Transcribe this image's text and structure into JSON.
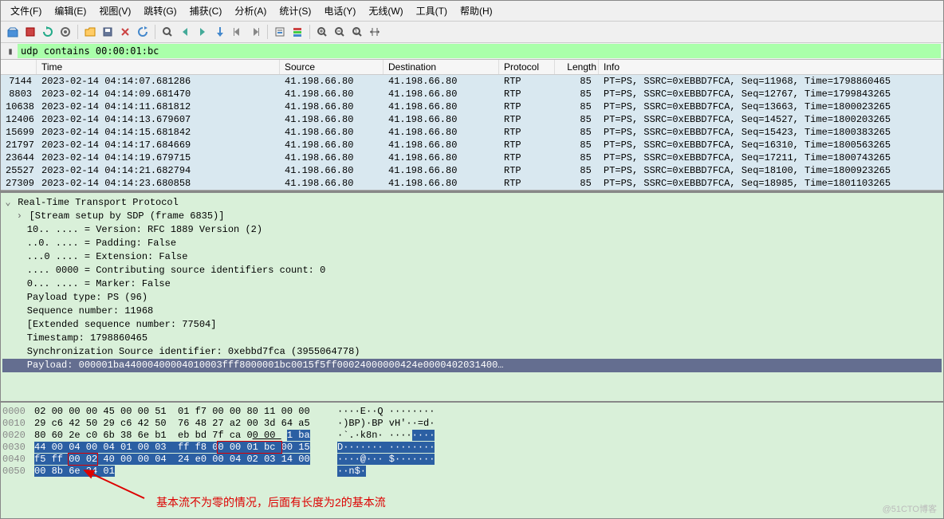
{
  "menu": [
    "文件(F)",
    "编辑(E)",
    "视图(V)",
    "跳转(G)",
    "捕获(C)",
    "分析(A)",
    "统计(S)",
    "电话(Y)",
    "无线(W)",
    "工具(T)",
    "帮助(H)"
  ],
  "filter": {
    "value": "udp contains 00:00:01:bc"
  },
  "columns": {
    "no": "",
    "time": "Time",
    "source": "Source",
    "destination": "Destination",
    "protocol": "Protocol",
    "length": "Length",
    "info": "Info"
  },
  "packets": [
    {
      "no": "7144",
      "time": "2023-02-14 04:14:07.681286",
      "src": "41.198.66.80",
      "dst": "41.198.66.80",
      "proto": "RTP",
      "len": "85",
      "info": "PT=PS, SSRC=0xEBBD7FCA, Seq=11968, Time=1798860465"
    },
    {
      "no": "8803",
      "time": "2023-02-14 04:14:09.681470",
      "src": "41.198.66.80",
      "dst": "41.198.66.80",
      "proto": "RTP",
      "len": "85",
      "info": "PT=PS, SSRC=0xEBBD7FCA, Seq=12767, Time=1799843265"
    },
    {
      "no": "10638",
      "time": "2023-02-14 04:14:11.681812",
      "src": "41.198.66.80",
      "dst": "41.198.66.80",
      "proto": "RTP",
      "len": "85",
      "info": "PT=PS, SSRC=0xEBBD7FCA, Seq=13663, Time=1800023265"
    },
    {
      "no": "12406",
      "time": "2023-02-14 04:14:13.679607",
      "src": "41.198.66.80",
      "dst": "41.198.66.80",
      "proto": "RTP",
      "len": "85",
      "info": "PT=PS, SSRC=0xEBBD7FCA, Seq=14527, Time=1800203265"
    },
    {
      "no": "15699",
      "time": "2023-02-14 04:14:15.681842",
      "src": "41.198.66.80",
      "dst": "41.198.66.80",
      "proto": "RTP",
      "len": "85",
      "info": "PT=PS, SSRC=0xEBBD7FCA, Seq=15423, Time=1800383265"
    },
    {
      "no": "21797",
      "time": "2023-02-14 04:14:17.684669",
      "src": "41.198.66.80",
      "dst": "41.198.66.80",
      "proto": "RTP",
      "len": "85",
      "info": "PT=PS, SSRC=0xEBBD7FCA, Seq=16310, Time=1800563265"
    },
    {
      "no": "23644",
      "time": "2023-02-14 04:14:19.679715",
      "src": "41.198.66.80",
      "dst": "41.198.66.80",
      "proto": "RTP",
      "len": "85",
      "info": "PT=PS, SSRC=0xEBBD7FCA, Seq=17211, Time=1800743265"
    },
    {
      "no": "25527",
      "time": "2023-02-14 04:14:21.682794",
      "src": "41.198.66.80",
      "dst": "41.198.66.80",
      "proto": "RTP",
      "len": "85",
      "info": "PT=PS, SSRC=0xEBBD7FCA, Seq=18100, Time=1800923265"
    },
    {
      "no": "27309",
      "time": "2023-02-14 04:14:23.680858",
      "src": "41.198.66.80",
      "dst": "41.198.66.80",
      "proto": "RTP",
      "len": "85",
      "info": "PT=PS, SSRC=0xEBBD7FCA, Seq=18985, Time=1801103265"
    }
  ],
  "details": {
    "header": "Real-Time Transport Protocol",
    "stream": "[Stream setup by SDP (frame 6835)]",
    "lines": [
      "10.. .... = Version: RFC 1889 Version (2)",
      "..0. .... = Padding: False",
      "...0 .... = Extension: False",
      ".... 0000 = Contributing source identifiers count: 0",
      "0... .... = Marker: False",
      "Payload type: PS (96)",
      "Sequence number: 11968",
      "[Extended sequence number: 77504]",
      "Timestamp: 1798860465",
      "Synchronization Source identifier: 0xebbd7fca (3955064778)"
    ],
    "payload": "Payload: 000001ba44000400004010003fff8000001bc0015f5ff00024000000424e0000402031400…"
  },
  "hex": {
    "offsets": [
      "0000",
      "0010",
      "0020",
      "0030",
      "0040",
      "0050"
    ],
    "bytes1": [
      "02 00 00 00 45 00 00 51",
      "29 c6 42 50 29 c6 42 50",
      "80 60 2e c0 6b 38 6e b1",
      "44 00 04 00 04 01 00 03",
      "f5 ff 00 02 40 00 00 04",
      "00 8b 6e 24 01"
    ],
    "bytes2": [
      "  01 f7 00 00 80 11 00 00",
      "  76 48 27 a2 00 3d 64 a5",
      "  eb bd 7f ca 00 00 01 ba",
      "  ff f8 00 00 01 bc 00 15",
      "  24 e0 00 04 02 03 14 00",
      ""
    ],
    "ascii": [
      "····E··Q ········",
      "·)BP)·BP vH'··=d·",
      "·`.·k8n· ········",
      "D······· ········",
      "····@··· $·······",
      "··n$·"
    ]
  },
  "annotation": "基本流不为零的情况，后面有长度为2的基本流",
  "watermark": "@51CTO博客"
}
